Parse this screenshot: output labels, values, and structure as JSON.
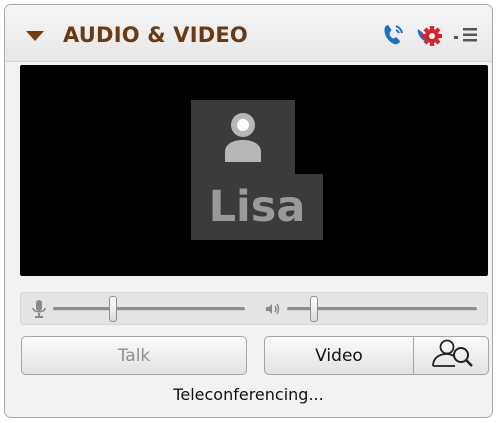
{
  "panel": {
    "title": "AUDIO & VIDEO",
    "accent_color": "#6a3a14",
    "header_icons": [
      "hand-phone-icon",
      "settings-gear-icon",
      "panel-menu-icon"
    ]
  },
  "video": {
    "participant_name": "Lisa",
    "participant_icon": "person-icon"
  },
  "audio": {
    "mic_icon": "microphone-icon",
    "speaker_icon": "speaker-icon",
    "mic_level": 0.31,
    "speaker_level": 0.14
  },
  "buttons": {
    "talk_label": "Talk",
    "video_label": "Video",
    "settings_icon": "video-settings-icon"
  },
  "status_text": "Teleconferencing..."
}
